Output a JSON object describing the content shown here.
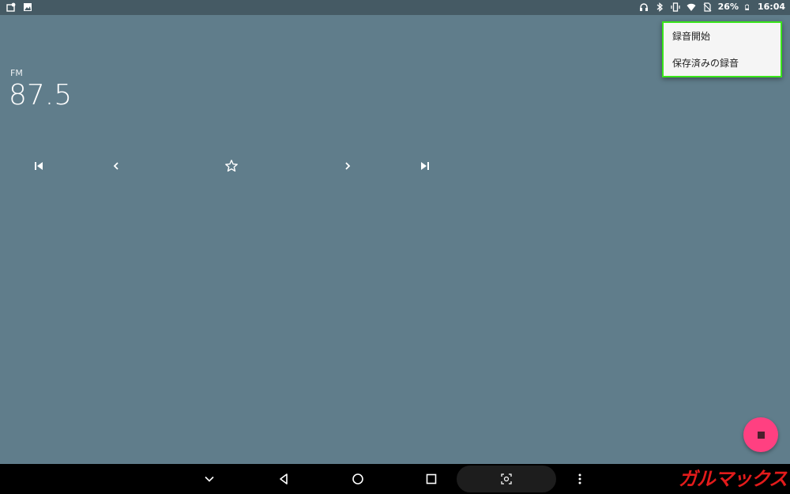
{
  "status_bar": {
    "battery": "26%",
    "time": "16:04",
    "left_icons": [
      "notification-icon",
      "image-icon"
    ],
    "right_icons": [
      "headphones-icon",
      "bluetooth-icon",
      "vibrate-icon",
      "wifi-icon",
      "no-sim-icon",
      "battery-icon"
    ]
  },
  "station": {
    "band": "FM",
    "frequency": "87.5"
  },
  "controls": {
    "icons": [
      "skip-previous-icon",
      "chevron-left-icon",
      "star-outline-icon",
      "chevron-right-icon",
      "skip-next-icon"
    ]
  },
  "menu": {
    "items": [
      {
        "label": "録音開始"
      },
      {
        "label": "保存済みの録音"
      }
    ],
    "highlight_color": "#39e51a"
  },
  "fab": {
    "icon": "stop-icon",
    "color": "#ff4081"
  },
  "nav_bar": {
    "icons": [
      "chevron-down-icon",
      "back-icon",
      "home-icon",
      "recents-icon",
      "screenshot-icon",
      "more-vert-icon"
    ]
  },
  "watermark": {
    "text": "ガルマックス",
    "color": "#e21b1b"
  },
  "colors": {
    "background": "#607d8b",
    "status_bar": "#455a64"
  }
}
